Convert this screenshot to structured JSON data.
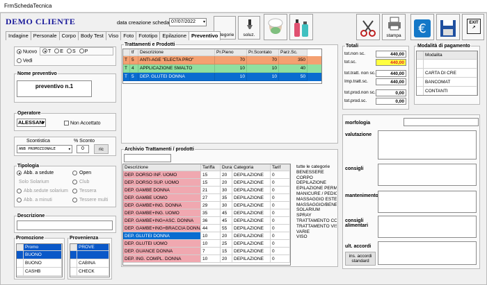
{
  "window": {
    "title": "FrmSchedaTecnica"
  },
  "header": {
    "app_title": "DEMO CLIENTE",
    "date_label": "data creazione scheda",
    "date_value": "07/07/2022"
  },
  "toolbar": {
    "categorie": "categorie",
    "soluz": "soluz.",
    "stampa": "stampa",
    "exit": "EXIT"
  },
  "tabs": [
    "Indagine",
    "Personale",
    "Corpo",
    "Body Test",
    "Viso",
    "Foto",
    "Fototipo",
    "Epilazione",
    "Preventivo"
  ],
  "active_tab": "Preventivo",
  "left": {
    "radio_nuovo": "Nuovo",
    "radio_vedi": "Vedi",
    "filters": [
      "T",
      "E",
      "S",
      "P"
    ],
    "nome_label": "Nome preventivo",
    "nome_value": "preventivo n.1",
    "operatore_label": "Operatore",
    "operatore_value": "ALESSAN",
    "non_accettato": "Non Accettato",
    "scontistica_label": "Scontistica",
    "sconto_label": "% Sconto",
    "scontistica_value": "ANB PROMOZIONALE",
    "sconto_value": "0",
    "ric_button": "ric",
    "tipologia_label": "Tipologia",
    "tipologia_options": [
      "Abb. a sedute",
      "Open",
      "Solo Solarium",
      "Club",
      "Abb.sedute solarium",
      "Tessera",
      "Abb. a minuti",
      "Tessere multi"
    ],
    "descrizione_label": "Descrizione",
    "promozione_label": "Promozione",
    "promozione_header": "Promo",
    "promozione_items": [
      "BUONO",
      "BUONO",
      "CASHB"
    ],
    "provenienza_label": "Provenienza",
    "provenienza_header": "PROVE",
    "provenienza_items": [
      "",
      "CABINA",
      "CHECK"
    ]
  },
  "trattamenti": {
    "label": "Trattamenti e Prodotti",
    "columns": [
      "tf",
      "Descrizione",
      "Pr.Pieno",
      "Pr.Scontato",
      "Parz.Sc."
    ],
    "rows": [
      {
        "t": "T",
        "q": "5",
        "desc": "ANTI-AGE \"ELECTA PRO\"",
        "pieno": "70",
        "scontato": "70",
        "parz": "350"
      },
      {
        "t": "T",
        "q": "4",
        "desc": "APPLICAZIONE SMALTO",
        "pieno": "10",
        "scontato": "10",
        "parz": "40"
      },
      {
        "t": "T",
        "q": "5",
        "desc": "DEP. GLUTEI DONNA",
        "pieno": "10",
        "scontato": "10",
        "parz": "50"
      }
    ]
  },
  "archivio": {
    "label": "Archivio Trattamenti / prodotti",
    "columns": [
      "Descrizione",
      "Tariffa",
      "Dura",
      "Categoria",
      "Tarif"
    ],
    "rows": [
      {
        "desc": "DEP. DORSO INF. UOMO",
        "tariffa": "15",
        "dura": "20",
        "cat": "DEPILAZIONE",
        "tarif": "0"
      },
      {
        "desc": "DEP. DORSO SUP. UOMO",
        "tariffa": "15",
        "dura": "20",
        "cat": "DEPILAZIONE",
        "tarif": "0"
      },
      {
        "desc": "DEP. GAMBE DONNA",
        "tariffa": "21",
        "dura": "30",
        "cat": "DEPILAZIONE",
        "tarif": "0"
      },
      {
        "desc": "DEP. GAMBE UOMO",
        "tariffa": "27",
        "dura": "35",
        "cat": "DEPILAZIONE",
        "tarif": "0"
      },
      {
        "desc": "DEP. GAMBE+ING. DONNA",
        "tariffa": "29",
        "dura": "30",
        "cat": "DEPILAZIONE",
        "tarif": "0"
      },
      {
        "desc": "DEP. GAMBE+ING. UOMO",
        "tariffa": "35",
        "dura": "45",
        "cat": "DEPILAZIONE",
        "tarif": "0"
      },
      {
        "desc": "DEP. GAMBE+ING+ASC. DONNA",
        "tariffa": "36",
        "dura": "45",
        "cat": "DEPILAZIONE",
        "tarif": "0"
      },
      {
        "desc": "DEP. GAMBE+ING+BRACCIA DONNA",
        "tariffa": "44",
        "dura": "55",
        "cat": "DEPILAZIONE",
        "tarif": "0"
      },
      {
        "desc": "DEP. GLUTEI DONNA",
        "tariffa": "10",
        "dura": "20",
        "cat": "DEPILAZIONE",
        "tarif": "0"
      },
      {
        "desc": "DEP. GLUTEI UOMO",
        "tariffa": "10",
        "dura": "25",
        "cat": "DEPILAZIONE",
        "tarif": "0"
      },
      {
        "desc": "DEP. GUANCE DONNA",
        "tariffa": "7",
        "dura": "15",
        "cat": "DEPILAZIONE",
        "tarif": "0"
      },
      {
        "desc": "DEP. ING. COMPL. DONNA",
        "tariffa": "10",
        "dura": "20",
        "cat": "DEPILAZIONE",
        "tarif": "0"
      }
    ],
    "selected_index": 8,
    "categories": [
      "tutte le categorie",
      "BENESSERE",
      "CORPO",
      "DEPILAZIONE",
      "EPILAZIONE PERMA",
      "MANICURE / PEDICU",
      "MASSAGGIO ESTET",
      "MASSAGGIO/BENE",
      "SOLARIUM",
      "SPRAY",
      "TRATTAMENTO CO",
      "TRATTAMENTO VIS",
      "VARIE",
      "VISO"
    ]
  },
  "totali": {
    "label": "Totali",
    "rows": [
      {
        "label": "tot.non sc.",
        "value": "440,00",
        "highlight": false
      },
      {
        "label": "tot.sc.",
        "value": "440,00",
        "highlight": true
      },
      {
        "label": "tot.tratt. non sc.",
        "value": "440,00",
        "highlight": false
      },
      {
        "label": "Imp.tratt.sc.",
        "value": "440,00",
        "highlight": false
      },
      {
        "label": "tot.prod.non sc.",
        "value": "0,00",
        "highlight": false
      },
      {
        "label": "tot.prod.sc.",
        "value": "0,00",
        "highlight": false
      }
    ]
  },
  "pagamento": {
    "label": "Modalità di pagamento",
    "header": "Modalita",
    "items": [
      "",
      "CARTA DI CRE",
      "BANCOMAT",
      "CONTANTI"
    ]
  },
  "notes": {
    "morfologia": "morfologia",
    "valutazione": "valutazione",
    "consigli": "consigli",
    "mantenimento": "mantenimento",
    "consigli_alimentari": "consigli alimentari",
    "ult_accordi": "ult. accordi",
    "ins_accordi": "ins. accordi standard"
  }
}
